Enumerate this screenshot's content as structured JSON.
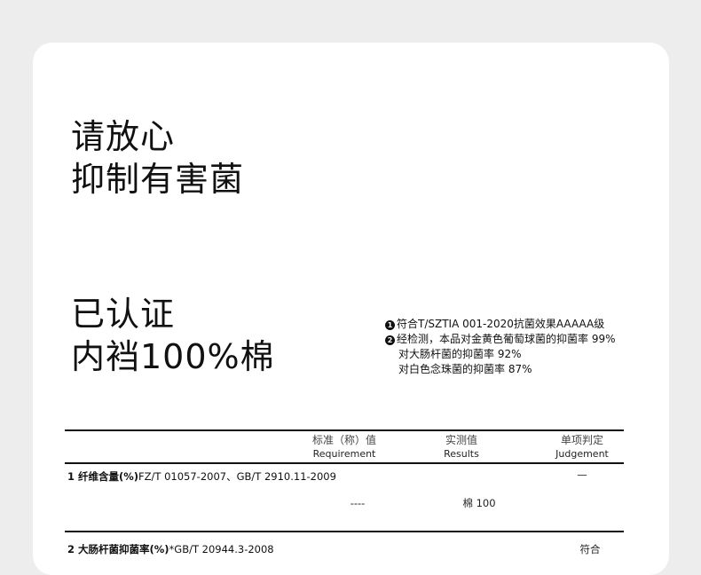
{
  "headline_1": {
    "line1": "请放心",
    "line2": "抑制有害菌"
  },
  "headline_2": {
    "line1": "已认证",
    "line2": "内裆100%棉"
  },
  "notes": [
    {
      "marker": "1",
      "text": "符合T/SZTIA 001-2020抗菌效果AAAAA级"
    },
    {
      "marker": "2",
      "text": "经检测，本品对金黄色葡萄球菌的抑菌率 99%"
    },
    {
      "marker": "",
      "text": "对大肠杆菌的抑菌率 92%"
    },
    {
      "marker": "",
      "text": "对白色念珠菌的抑菌率 87%"
    }
  ],
  "table": {
    "columns": [
      {
        "cn": "标准（称）值",
        "en": "Requirement"
      },
      {
        "cn": "实测值",
        "en": "Results"
      },
      {
        "cn": "单项判定",
        "en": "Judgement"
      }
    ],
    "rows": [
      {
        "title_bold": "1 纤维含量(%)",
        "title_rest": "FZ/T 01057-2007、GB/T 2910.11-2009",
        "judgement": "—",
        "requirement": "----",
        "result": "棉 100"
      },
      {
        "title_bold": "2 大肠杆菌抑菌率(%)",
        "title_rest": "*GB/T 20944.3-2008",
        "judgement": "符合"
      }
    ]
  }
}
